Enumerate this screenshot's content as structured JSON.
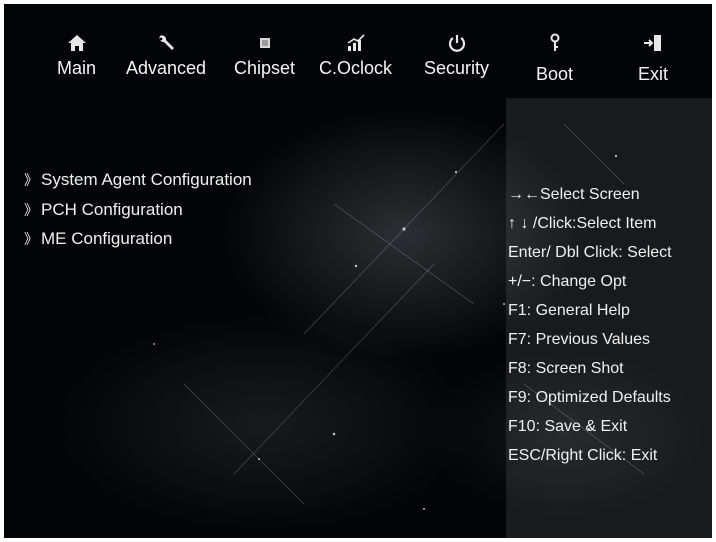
{
  "tabs": [
    {
      "label": "Main",
      "icon": "home-icon"
    },
    {
      "label": "Advanced",
      "icon": "wrench-icon"
    },
    {
      "label": "Chipset",
      "icon": "chip-icon"
    },
    {
      "label": "C.Oclock",
      "icon": "chart-icon"
    },
    {
      "label": "Security",
      "icon": "power-icon"
    },
    {
      "label": "Boot",
      "icon": "key-icon"
    },
    {
      "label": "Exit",
      "icon": "exit-icon"
    }
  ],
  "menu": {
    "items": [
      {
        "chevron": "》",
        "label": "System Agent Configuration"
      },
      {
        "chevron": "》",
        "label": "PCH Configuration"
      },
      {
        "chevron": "》",
        "label": "ME Configuration"
      }
    ]
  },
  "help": {
    "lines": [
      "→←Select Screen",
      "↑ ↓ /Click:Select Item",
      "Enter/ Dbl Click: Select",
      "+/−: Change Opt",
      "F1: General Help",
      "F7: Previous Values",
      "F8: Screen Shot",
      "F9: Optimized Defaults",
      "F10: Save & Exit",
      "ESC/Right Click: Exit"
    ]
  }
}
